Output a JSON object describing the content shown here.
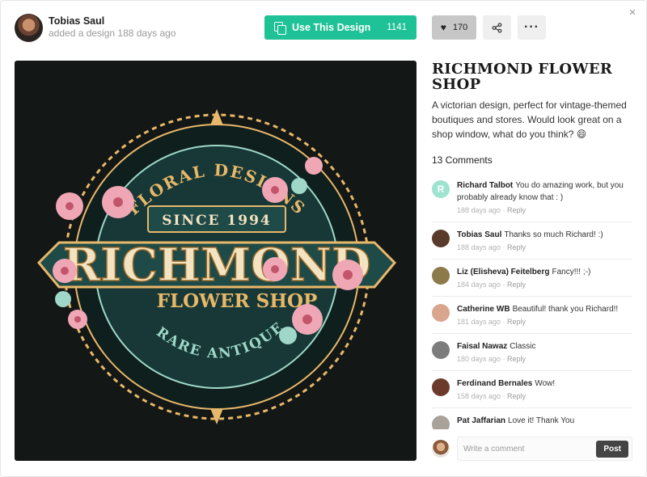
{
  "header": {
    "author_name": "Tobias Saul",
    "author_subtitle": "added a design 188 days ago",
    "use_design_label": "Use This Design",
    "use_design_count": "1141",
    "likes": "170",
    "close_glyph": "×",
    "more_glyph": "···"
  },
  "design": {
    "title": "RICHMOND FLOWER SHOP",
    "description": "A victorian design, perfect for vintage-themed boutiques and stores. Would look great on a shop window, what do you think? 😄",
    "artwork": {
      "banner_top": "FLORAL DESIGNS",
      "since": "SINCE 1994",
      "name": "RICHMOND",
      "subtitle": "FLOWER SHOP",
      "banner_bottom": "& RARE ANTIQUES"
    }
  },
  "comments": {
    "title": "13 Comments",
    "reply_label": "Reply",
    "items": [
      {
        "name": "Richard Talbot",
        "text": "You do amazing work, but you probably already know that : )",
        "time": "188 days ago",
        "avatar_letter": "R",
        "avatar_color": "#9de3d0"
      },
      {
        "name": "Tobias Saul",
        "text": "Thanks so much Richard! :)",
        "time": "188 days ago",
        "avatar_letter": "",
        "avatar_color": "#5a3a2a"
      },
      {
        "name": "Liz (Elisheva) Feitelberg",
        "text": "Fancy!!! ;-)",
        "time": "184 days ago",
        "avatar_letter": "",
        "avatar_color": "#8c7a4a"
      },
      {
        "name": "Catherine WB",
        "text": "Beautiful! thank you Richard!!",
        "time": "181 days ago",
        "avatar_letter": "",
        "avatar_color": "#d9a58c"
      },
      {
        "name": "Faisal Nawaz",
        "text": "Classic",
        "time": "180 days ago",
        "avatar_letter": "",
        "avatar_color": "#7c7c7c"
      },
      {
        "name": "Ferdinand Bernales",
        "text": "Wow!",
        "time": "158 days ago",
        "avatar_letter": "",
        "avatar_color": "#6b3a2a"
      },
      {
        "name": "Pat Jaffarian",
        "text": "Love it! Thank You",
        "time": "",
        "avatar_letter": "",
        "avatar_color": "#a8a29a"
      }
    ]
  },
  "composer": {
    "placeholder": "Write a comment",
    "post_label": "Post"
  },
  "colors": {
    "accent": "#1fc196",
    "art_background": "#131715",
    "art_gold": "#e8b86a",
    "art_teal": "#1e4a48",
    "art_mint": "#9fd8c8",
    "art_pink": "#f0a7b5"
  }
}
